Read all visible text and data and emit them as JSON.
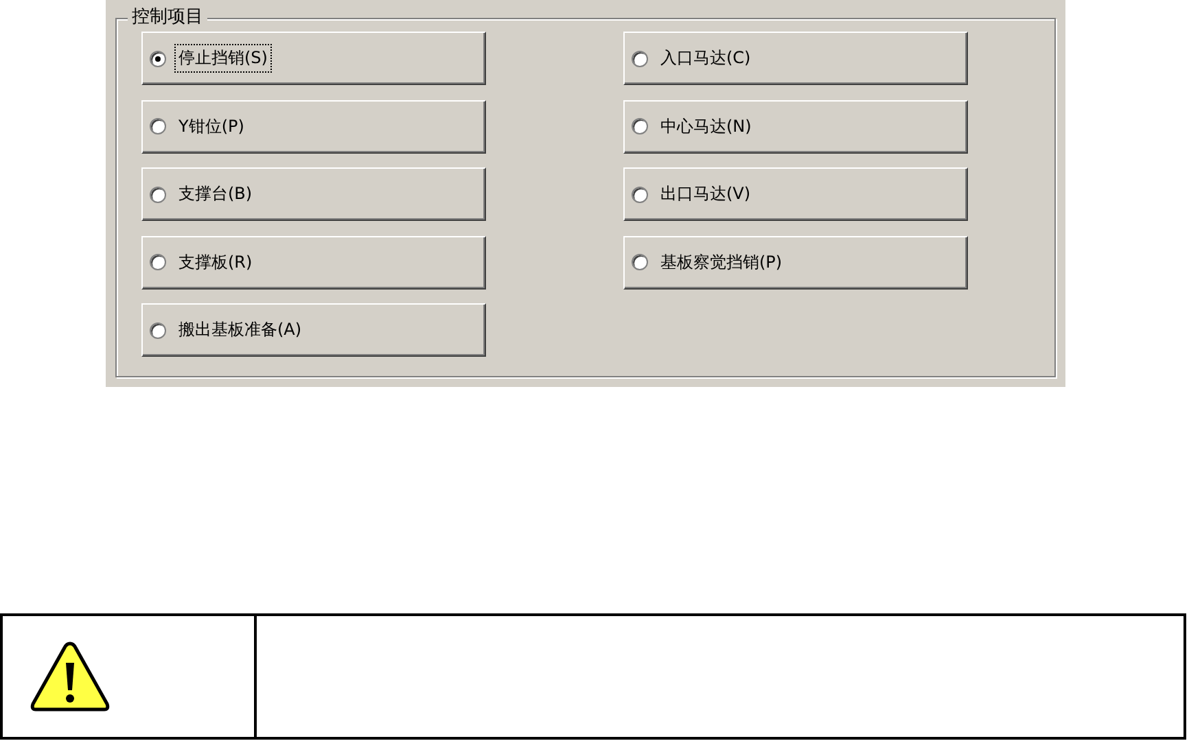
{
  "group": {
    "title": "控制项目",
    "options": [
      {
        "label": "停止挡销(S)",
        "selected": true
      },
      {
        "label": "入口马达(C)",
        "selected": false
      },
      {
        "label": "Y钳位(P)",
        "selected": false
      },
      {
        "label": "中心马达(N)",
        "selected": false
      },
      {
        "label": "支撑台(B)",
        "selected": false
      },
      {
        "label": "出口马达(V)",
        "selected": false
      },
      {
        "label": "支撑板(R)",
        "selected": false
      },
      {
        "label": "基板察觉挡销(P)",
        "selected": false
      },
      {
        "label": "搬出基板准备(A)",
        "selected": false
      }
    ]
  },
  "notice": {
    "kind": "warning"
  }
}
